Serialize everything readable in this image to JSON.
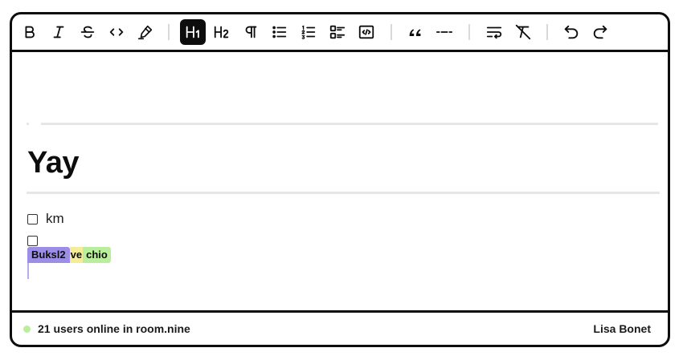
{
  "toolbar": {
    "groups": [
      [
        {
          "name": "bold-button",
          "icon": "bold-icon",
          "active": false
        },
        {
          "name": "italic-button",
          "icon": "italic-icon",
          "active": false
        },
        {
          "name": "strike-button",
          "icon": "strikethrough-icon",
          "active": false
        },
        {
          "name": "code-button",
          "icon": "code-icon",
          "active": false
        },
        {
          "name": "highlight-button",
          "icon": "marker-icon",
          "active": false
        }
      ],
      [
        {
          "name": "heading1-button",
          "icon": "heading1-icon",
          "active": true
        },
        {
          "name": "heading2-button",
          "icon": "heading2-icon",
          "active": false
        },
        {
          "name": "paragraph-button",
          "icon": "paragraph-icon",
          "active": false
        },
        {
          "name": "bullet-list-button",
          "icon": "bullet-list-icon",
          "active": false
        },
        {
          "name": "ordered-list-button",
          "icon": "ordered-list-icon",
          "active": false
        },
        {
          "name": "task-list-button",
          "icon": "task-list-icon",
          "active": false
        },
        {
          "name": "code-block-button",
          "icon": "code-block-icon",
          "active": false
        }
      ],
      [
        {
          "name": "blockquote-button",
          "icon": "quote-icon",
          "active": false
        },
        {
          "name": "horizontal-rule-button",
          "icon": "horizontal-rule-icon",
          "active": false
        }
      ],
      [
        {
          "name": "hard-break-button",
          "icon": "text-wrap-icon",
          "active": false
        },
        {
          "name": "clear-format-button",
          "icon": "clear-format-icon",
          "active": false
        }
      ],
      [
        {
          "name": "undo-button",
          "icon": "undo-icon",
          "active": false
        },
        {
          "name": "redo-button",
          "icon": "redo-icon",
          "active": false
        }
      ]
    ]
  },
  "document": {
    "heading": "Yay",
    "tasks": [
      {
        "text": "km",
        "checked": false
      },
      {
        "text": "",
        "checked": false
      }
    ],
    "collab": {
      "cursor_user": "Buksl2",
      "yellow_text": "ve",
      "green_text": "chio"
    }
  },
  "footer": {
    "status": "21 users online in room.nine",
    "user": "Lisa Bonet",
    "status_color": "#b9ee9a"
  },
  "colors": {
    "cursor_purple": "#9c8ee6",
    "highlight_yellow": "#f5ec9a",
    "highlight_green": "#b9ee9a"
  }
}
